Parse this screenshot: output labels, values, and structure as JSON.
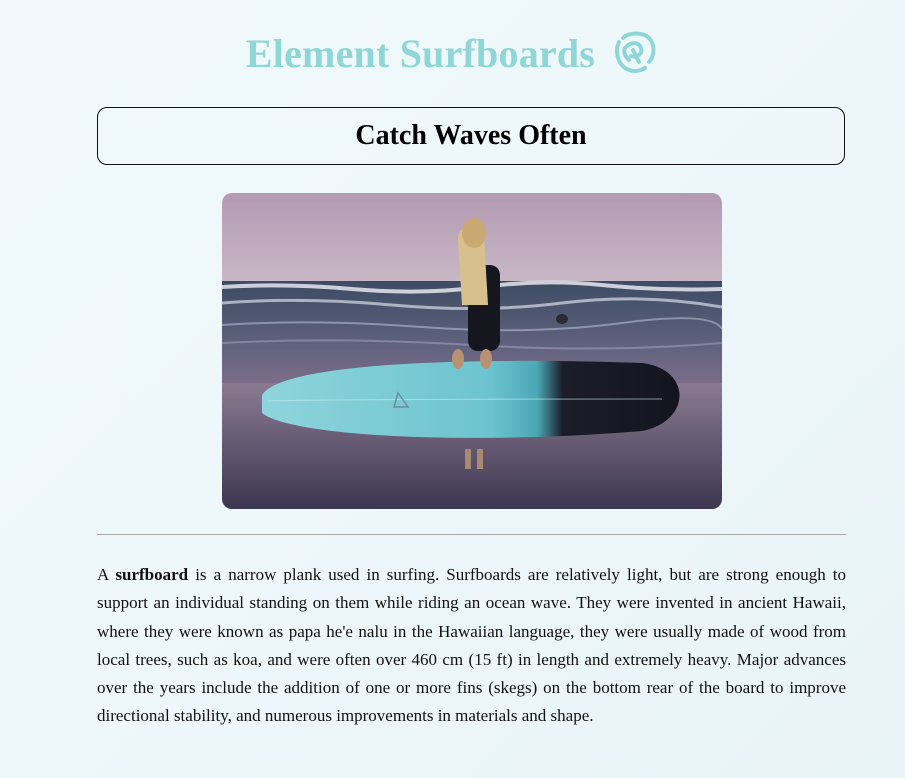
{
  "header": {
    "title": "Element Surfboards",
    "logo_icon": "hibiscus-flower-icon",
    "title_color": "#8fd6d6"
  },
  "tagline": {
    "text": "Catch Waves Often"
  },
  "photo": {
    "icon": "surfer-with-surfboard-photo"
  },
  "description": {
    "lead": "A ",
    "term": "surfboard",
    "body": " is a narrow plank used in surfing. Surfboards are relatively light, but are strong enough to support an individual standing on them while riding an ocean wave. They were invented in ancient Hawaii, where they were known as papa he'e nalu in the Hawaiian language, they were usually made of wood from local trees, such as koa, and were often over 460 cm (15 ft) in length and extremely heavy. Major advances over the years include the addition of one or more fins (skegs) on the bottom rear of the board to improve directional stability, and numerous improvements in materials and shape."
  }
}
